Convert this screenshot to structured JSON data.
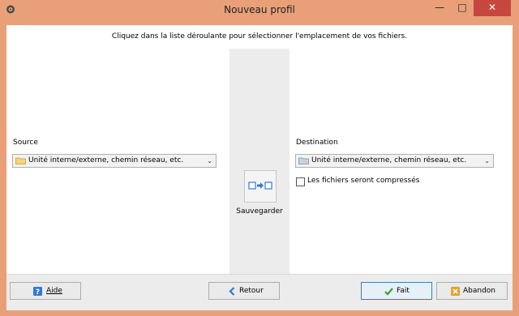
{
  "window": {
    "title": "Nouveau profil",
    "minimize_glyph": "—",
    "maximize_glyph": "□",
    "close_glyph": "✕"
  },
  "header": {
    "instruction": "Cliquez dans la liste déroulante pour sélectionner l'emplacement de vos fichiers."
  },
  "source": {
    "label": "Source",
    "selected": "Unité interne/externe, chemin réseau, etc.",
    "icon": "folder-icon"
  },
  "destination": {
    "label": "Destination",
    "selected": "Unité interne/externe, chemin réseau, etc.",
    "icon": "folder-icon",
    "compress_label": "Les fichiers seront compressés",
    "compress_checked": false
  },
  "middle": {
    "action_label": "Sauvegarder",
    "icon": "backup-arrow-icon"
  },
  "footer": {
    "help": "Aide",
    "back": "Retour",
    "done": "Fait",
    "cancel": "Abandon"
  },
  "colors": {
    "titlebar": "#e9a079",
    "close": "#c7463e",
    "accent": "#2f7bd5",
    "check_green": "#3aa03a",
    "cancel_orange": "#e8a030"
  }
}
